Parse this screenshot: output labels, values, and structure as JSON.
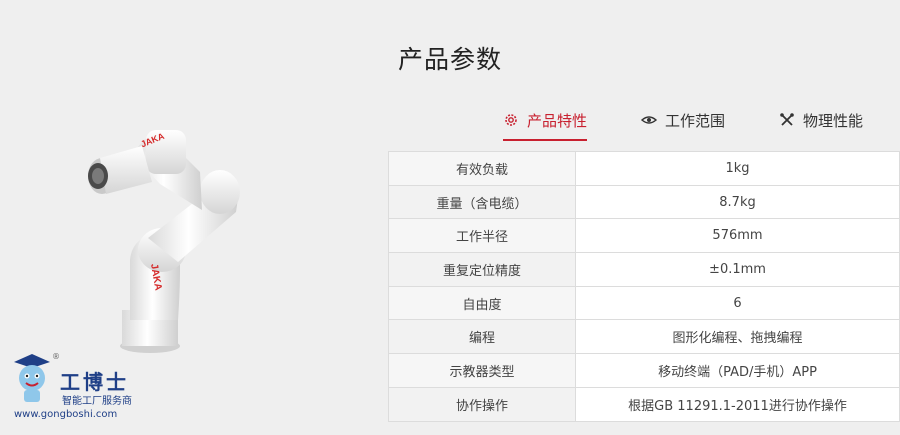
{
  "page": {
    "title": "产品参数"
  },
  "robot": {
    "brand_mark": "JAKA"
  },
  "logo": {
    "brand": "工博士",
    "subtitle": "智能工厂服务商",
    "url": "www.gongboshi.com",
    "reg": "®"
  },
  "tabs": [
    {
      "label": "产品特性",
      "icon": "gear-icon",
      "active": true
    },
    {
      "label": "工作范围",
      "icon": "eye-icon",
      "active": false
    },
    {
      "label": "物理性能",
      "icon": "tools-icon",
      "active": false
    }
  ],
  "specs": [
    {
      "key": "有效负载",
      "value": "1kg"
    },
    {
      "key": "重量（含电缆）",
      "value": "8.7kg"
    },
    {
      "key": "工作半径",
      "value": "576mm"
    },
    {
      "key": "重复定位精度",
      "value": "±0.1mm"
    },
    {
      "key": "自由度",
      "value": "6"
    },
    {
      "key": "编程",
      "value": "图形化编程、拖拽编程"
    },
    {
      "key": "示教器类型",
      "value": "移动终端（PAD/手机）APP"
    },
    {
      "key": "协作操作",
      "value": "根据GB 11291.1-2011进行协作操作"
    }
  ],
  "colors": {
    "accent": "#c8202f",
    "brand_blue": "#1f3f87"
  }
}
